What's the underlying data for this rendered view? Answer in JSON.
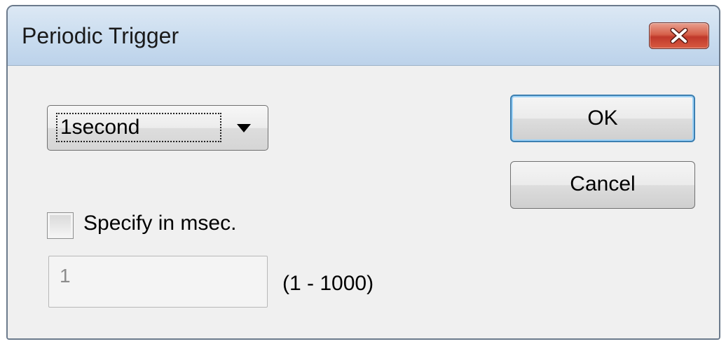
{
  "window": {
    "title": "Periodic Trigger"
  },
  "interval_select": {
    "selected": "1second"
  },
  "buttons": {
    "ok_label": "OK",
    "cancel_label": "Cancel"
  },
  "msec_option": {
    "checkbox_label": "Specify in msec.",
    "checked": false,
    "input_value": "1",
    "input_disabled": true,
    "range_label": "(1 - 1000)"
  },
  "icons": {
    "close": "close-icon",
    "dropdown": "chevron-down-icon"
  },
  "colors": {
    "close_button": "#c0392b",
    "focus_border": "#3c7fb1"
  }
}
